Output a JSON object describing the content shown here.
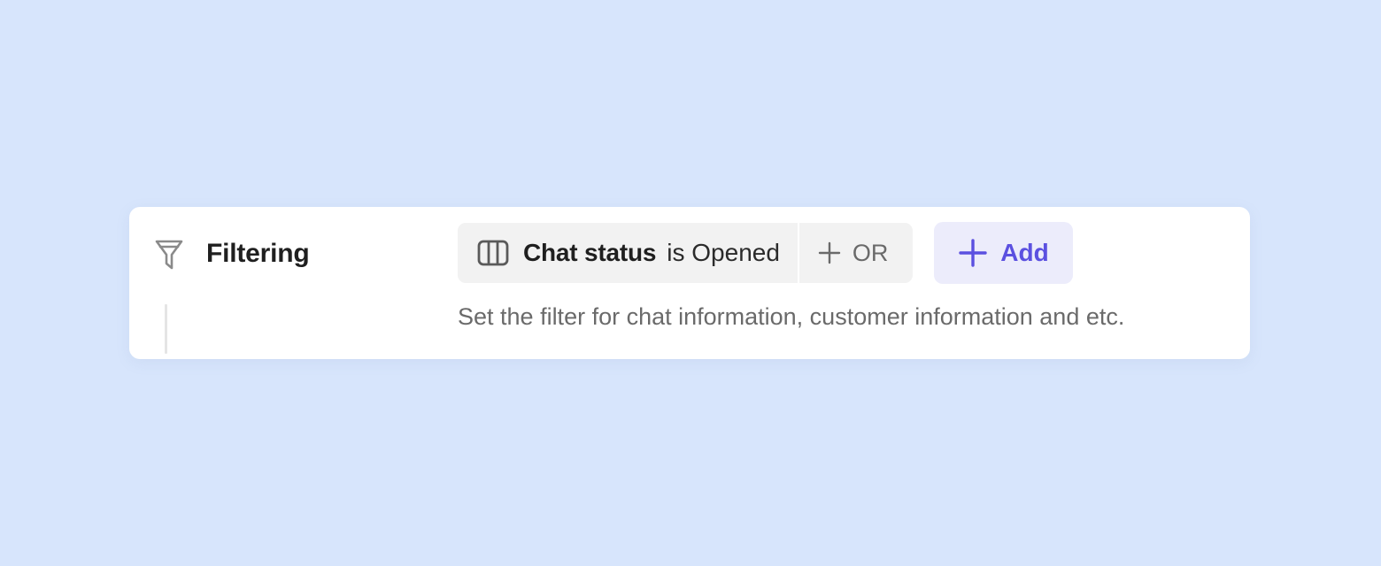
{
  "section": {
    "title": "Filtering",
    "icon": "filter-icon",
    "description": "Set the filter for chat information, customer information and etc."
  },
  "filter_chip": {
    "icon": "columns-icon",
    "field": "Chat status",
    "condition": "is Opened"
  },
  "or_button": {
    "icon": "plus-icon",
    "label": "OR"
  },
  "add_button": {
    "icon": "plus-icon",
    "label": "Add"
  },
  "colors": {
    "background": "#d7e5fc",
    "card": "#ffffff",
    "chip": "#f2f2f2",
    "accent": "#5b50e0",
    "accent_bg": "#ececfb",
    "text_primary": "#1f1f1f",
    "text_secondary": "#6a6a6a"
  }
}
